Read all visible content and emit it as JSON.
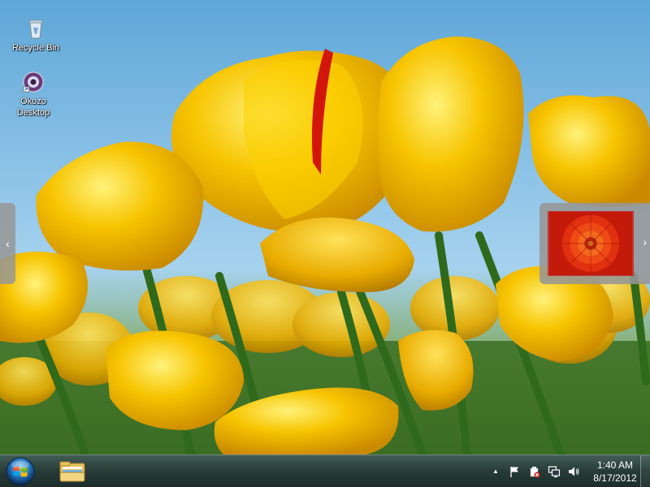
{
  "desktop": {
    "icons": [
      {
        "label": "Recycle Bin",
        "icon": "recycle-bin-icon"
      },
      {
        "label": "Okozo\nDesktop",
        "icon": "okozo-desktop-icon"
      }
    ],
    "wallpaper": "yellow-tulips"
  },
  "side_panels": {
    "left_arrow": "‹",
    "right_arrow": "›",
    "preview": "red-flower-wallpaper-thumbnail"
  },
  "taskbar": {
    "start_icon": "windows-start-orb-icon",
    "pinned": [
      {
        "icon": "file-explorer-icon"
      }
    ],
    "tray": {
      "show_hidden": "▲",
      "icons": [
        "action-center-flag-icon",
        "power-icon",
        "network-icon",
        "volume-icon"
      ],
      "time": "1:40 AM",
      "date": "8/17/2012"
    }
  },
  "colors": {
    "tulip_yellow": "#f3b800",
    "sky_blue": "#6aaed9",
    "taskbar": "#26363f"
  }
}
